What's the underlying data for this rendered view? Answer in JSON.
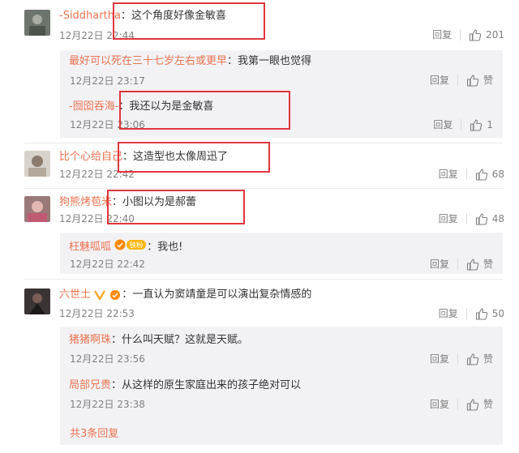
{
  "comments": [
    {
      "user": "-Siddhartha",
      "text": "这个角度好像金敏喜",
      "time": "12月22日 22:44",
      "reply": "回复",
      "likes": "201"
    },
    {
      "user": "比个心给自己",
      "text": "这造型也太像周迅了",
      "time": "12月22日 22:42",
      "reply": "回复",
      "likes": "68"
    },
    {
      "user": "狗熊烤苞米",
      "text": "小图以为是郝蕾",
      "time": "12月22日 22:40",
      "reply": "回复",
      "likes": "48"
    },
    {
      "user": "六世土",
      "text": "一直认为窦靖童是可以演出复杂情感的",
      "time": "12月22日 22:53",
      "reply": "回复",
      "likes": "50"
    }
  ],
  "replies": [
    {
      "user": "最好可以死在三十七岁左右或更早",
      "text": "我第一眼也觉得",
      "time": "12月22日 23:17",
      "reply": "回复",
      "likes": "赞"
    },
    {
      "user": "-囫囵吞海-",
      "text": "我还以为是金敏喜",
      "time": "12月22日 23:06",
      "reply": "回复",
      "likes": "1"
    },
    {
      "user": "枉魅呱呱",
      "badge": "铁粉",
      "text": "我也!",
      "time": "12月22日 22:42",
      "reply": "回复",
      "likes": "赞"
    },
    {
      "user": "猪猪啊珠",
      "text": "什么叫天赋？这就是天赋。",
      "time": "12月22日 23:56",
      "reply": "回复",
      "likes": "赞"
    },
    {
      "user": "局部兄贵",
      "text": "从这样的原生家庭出来的孩子绝对可以",
      "time": "12月22日 23:38",
      "reply": "回复",
      "likes": "赞"
    }
  ],
  "more_replies": "共3条回复",
  "colors": {
    "username": "#eb7350",
    "annotation_box": "#e0363b",
    "reply_bg": "#f2f2f5"
  }
}
